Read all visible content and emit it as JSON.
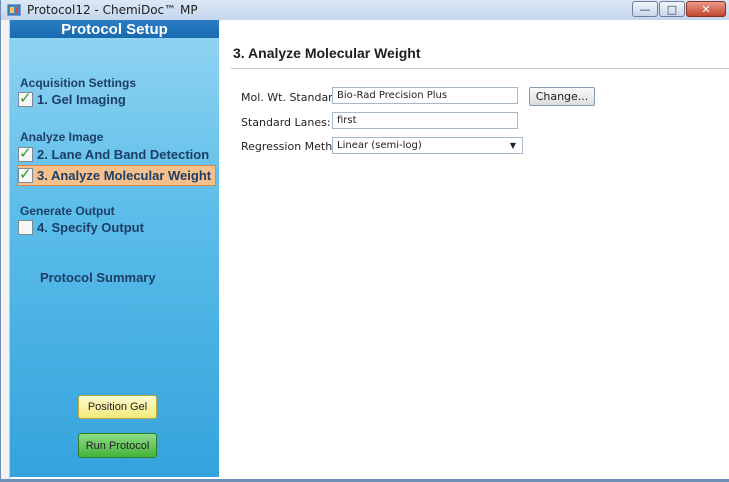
{
  "window": {
    "title": "Protocol12 - ChemiDoc™ MP",
    "controls": {
      "minimize": "—",
      "maximize": "□",
      "close": "✕"
    }
  },
  "sidebar": {
    "header": "Protocol Setup",
    "sections": [
      {
        "label": "Acquisition Settings",
        "steps": [
          {
            "label": "1. Gel Imaging",
            "checked": true
          }
        ]
      },
      {
        "label": "Analyze Image",
        "steps": [
          {
            "label": "2. Lane And Band Detection",
            "checked": true
          },
          {
            "label": "3. Analyze Molecular Weight",
            "checked": true,
            "active": true
          }
        ]
      },
      {
        "label": "Generate Output",
        "steps": [
          {
            "label": "4. Specify Output",
            "checked": false
          }
        ]
      }
    ],
    "summary": "Protocol Summary",
    "position_gel_button": "Position Gel",
    "run_protocol_button": "Run Protocol"
  },
  "main": {
    "title": "3. Analyze Molecular Weight",
    "mol_wt_label": "Mol. Wt. Standard:",
    "mol_wt_value": "Bio-Rad Precision Plus",
    "change_button": "Change...",
    "lanes_label": "Standard Lanes:",
    "lanes_value": "first",
    "regression_label": "Regression Method:",
    "regression_value": "Linear (semi-log)"
  },
  "colors": {
    "accent": "#1868ad",
    "active_step": "#f6c08c",
    "check": "#2f9b2f",
    "run_button": "#43b33a",
    "position_button": "#f5ea7a"
  }
}
